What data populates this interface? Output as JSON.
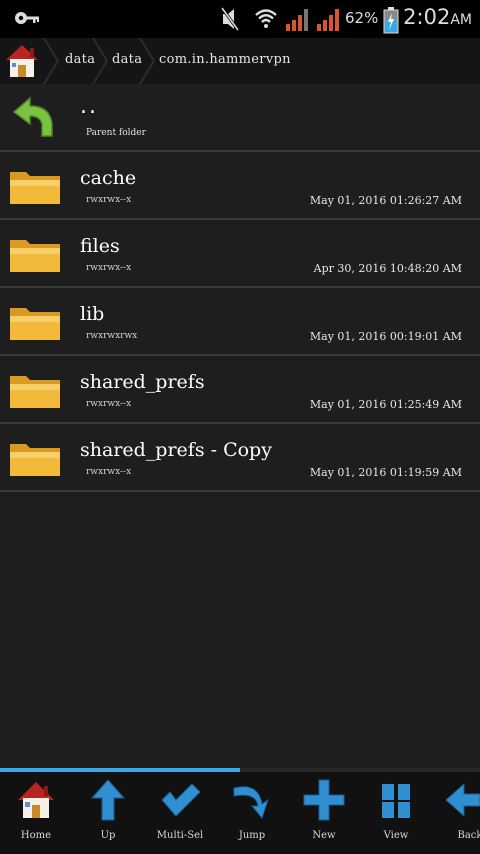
{
  "status": {
    "battery": "62%",
    "time": "2:02",
    "ampm": "AM"
  },
  "breadcrumb": [
    "data",
    "data",
    "com.in.hammervpn"
  ],
  "parent": {
    "dots": "..",
    "label": "Parent folder"
  },
  "items": [
    {
      "name": "cache",
      "perm": "rwxrwx--x",
      "date": "May 01, 2016 01:26:27 AM"
    },
    {
      "name": "files",
      "perm": "rwxrwx--x",
      "date": "Apr 30, 2016 10:48:20 AM"
    },
    {
      "name": "lib",
      "perm": "rwxrwxrwx",
      "date": "May 01, 2016 00:19:01 AM"
    },
    {
      "name": "shared_prefs",
      "perm": "rwxrwx--x",
      "date": "May 01, 2016 01:25:49 AM"
    },
    {
      "name": "shared_prefs - Copy",
      "perm": "rwxrwx--x",
      "date": "May 01, 2016 01:19:59 AM"
    }
  ],
  "progress": 0.5,
  "toolbar": {
    "home": "Home",
    "up": "Up",
    "multisel": "Multi-Sel",
    "jump": "Jump",
    "new": "New",
    "view": "View",
    "back": "Back"
  },
  "colors": {
    "accent": "#3aa7e6",
    "folder": "#f2b93b",
    "arrow": "#7cc242"
  }
}
